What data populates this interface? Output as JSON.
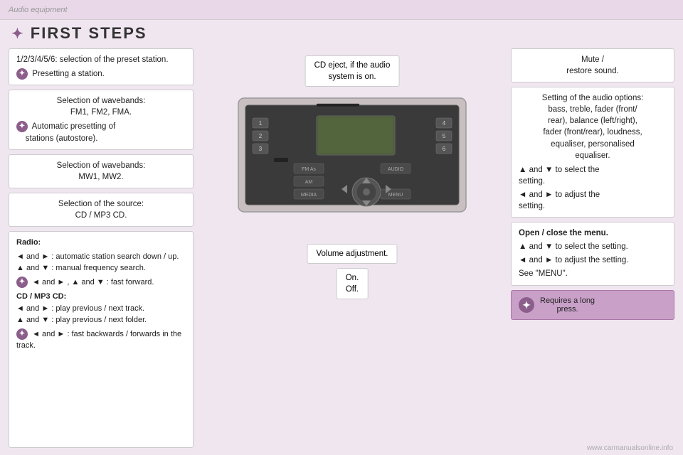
{
  "header": {
    "label": "Audio equipment"
  },
  "title": {
    "icon": "✦",
    "text": "FIRST STEPS"
  },
  "left_column": {
    "preset_box": {
      "text": "1/2/3/4/5/6: selection of the preset station.",
      "note": "Presetting a station."
    },
    "wavebands1_box": {
      "title": "Selection of wavebands:",
      "subtitle": "FM1, FM2, FMA.",
      "note": "Automatic presetting of\nstations (autostore)."
    },
    "wavebands2_box": {
      "title": "Selection of wavebands:",
      "subtitle": "MW1, MW2."
    },
    "source_box": {
      "title": "Selection of the source:",
      "subtitle": "CD / MP3 CD."
    },
    "radio_box": {
      "title": "Radio:",
      "lines": [
        "◄ and ► : automatic station search down / up.",
        "▲ and ▼ : manual frequency search.",
        "◄ and ► , ▲ and ▼ : fast forward.",
        "CD / MP3 CD:",
        "◄ and ► : play previous / next track.",
        "▲ and ▼ : play previous / next folder.",
        "◄ and ► : fast backwards / forwards in the track."
      ],
      "note_lines": [
        "◄ and ► , ▲ and ▼ : fast forward.",
        "◄ and ► : fast backwards / forwards in the track."
      ]
    }
  },
  "center_column": {
    "cd_eject_label": "CD eject, if the audio\nsystem is on.",
    "volume_label": "Volume adjustment.",
    "on_off_label": "On.\nOff."
  },
  "right_column": {
    "mute_box": {
      "title": "Mute /\nrestore sound."
    },
    "audio_options_box": {
      "text": "Setting of the audio options:\nbass, treble, fader (front/\nrear), balance (left/right),\nfader (front/rear), loudness,\nequaliser, personalised\nequaliser.",
      "line1": "▲ and ▼ to select the setting.",
      "line2": "◄ and ► to adjust the setting."
    },
    "menu_box": {
      "title": "Open / close the menu.",
      "line1": "▲ and ▼ to select the setting.",
      "line2": "◄ and ► to adjust the setting.",
      "line3": "See \"MENU\"."
    },
    "long_press_box": {
      "text": "Requires a long\npress."
    }
  },
  "watermark": {
    "text": "www.carmanualsonline.info"
  }
}
